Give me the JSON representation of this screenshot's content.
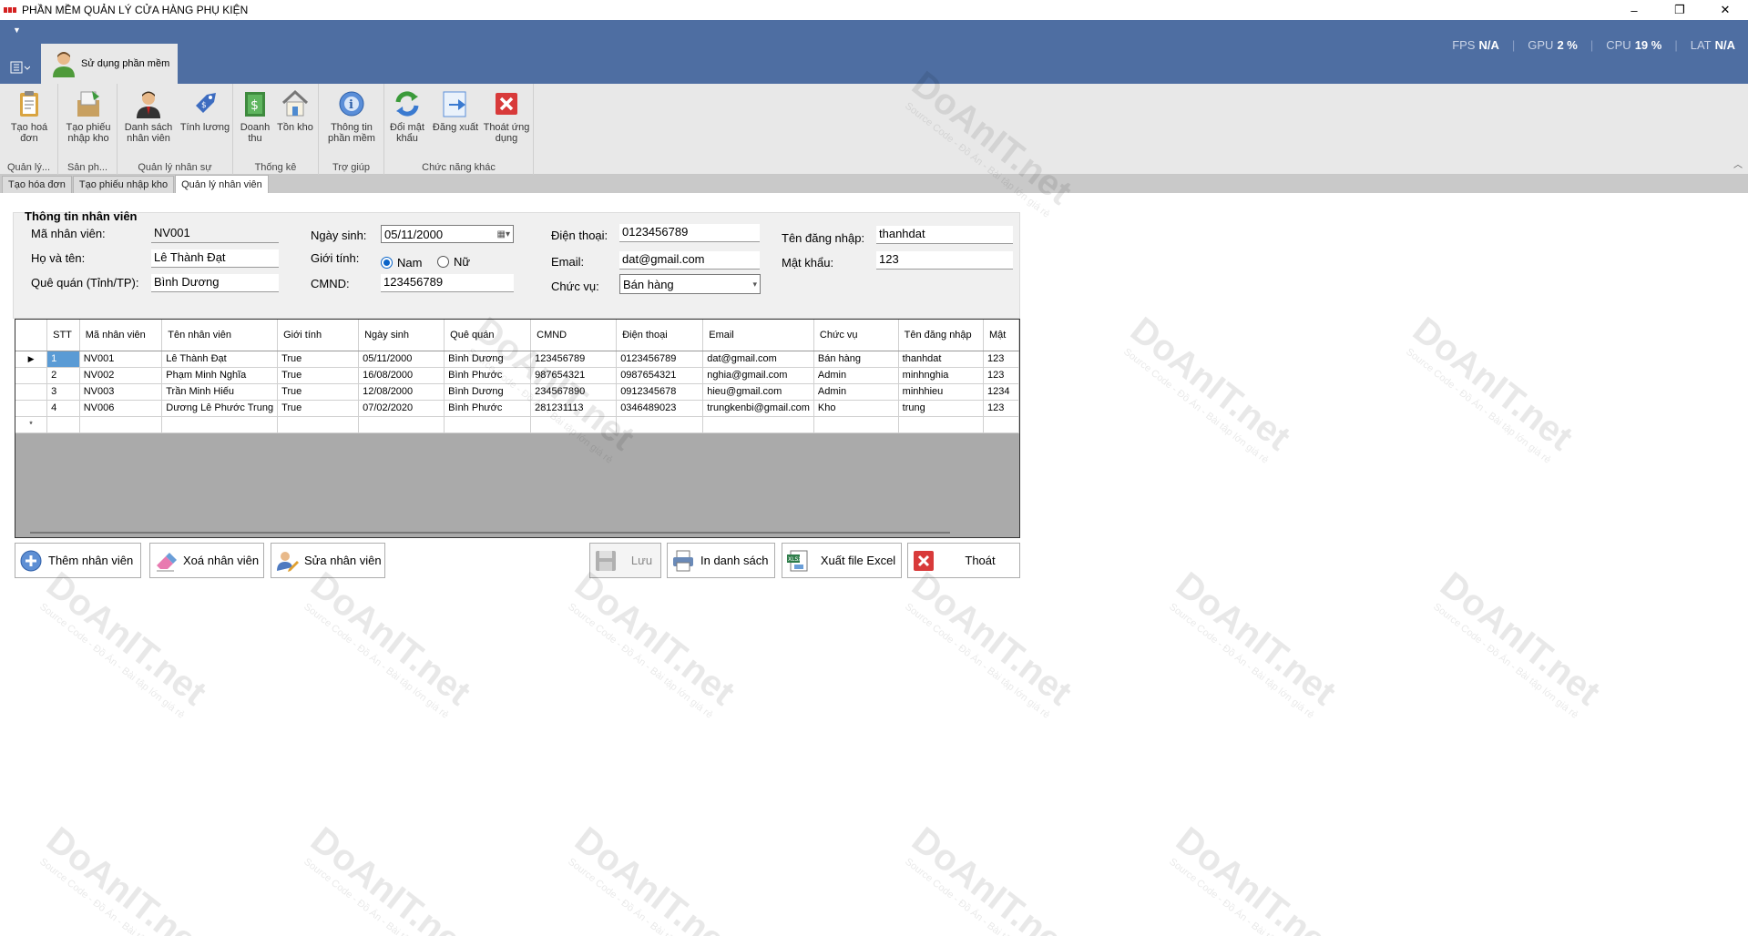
{
  "window": {
    "title": "PHẦN MỀM QUẢN LÝ CỬA HÀNG PHỤ KIỆN",
    "minimize": "–",
    "restore": "❐",
    "close": "✕"
  },
  "stats": [
    {
      "label": "FPS",
      "value": "N/A"
    },
    {
      "label": "GPU",
      "value": "2 %"
    },
    {
      "label": "CPU",
      "value": "19 %"
    },
    {
      "label": "LAT",
      "value": "N/A"
    }
  ],
  "ribbon": {
    "tab_label": "Sử dụng phần mềm",
    "groups": [
      {
        "label": "Quản lý..."
      },
      {
        "label": "Sản ph..."
      },
      {
        "label": "Quản lý nhân sự"
      },
      {
        "label": "Thống kê"
      },
      {
        "label": "Trợ giúp"
      },
      {
        "label": "Chức năng khác"
      }
    ],
    "buttons": {
      "create_invoice": "Tạo hoá đơn",
      "create_receipt": "Tạo phiếu nhập kho",
      "employee_list": "Danh sách nhân viên",
      "payroll": "Tính lương",
      "revenue": "Doanh thu",
      "stock": "Tồn kho",
      "info": "Thông tin phần mềm",
      "change_password": "Đổi mật khẩu",
      "logout": "Đăng xuất",
      "exit": "Thoát ứng dụng"
    }
  },
  "doc_tabs": [
    "Tạo hóa đơn",
    "Tạo phiếu nhập kho",
    "Quản lý nhân viên"
  ],
  "form": {
    "title": "Thông tin nhân viên",
    "labels": {
      "id": "Mã nhân viên:",
      "name": "Họ và tên:",
      "hometown": "Quê quán (Tỉnh/TP):",
      "dob": "Ngày sinh:",
      "gender": "Giới tính:",
      "cmnd": "CMND:",
      "phone": "Điện thoại:",
      "email": "Email:",
      "position": "Chức vụ:",
      "username": "Tên đăng nhập:",
      "password": "Mật khẩu:"
    },
    "values": {
      "id": "NV001",
      "name": "Lê Thành Đạt",
      "hometown": "Bình Dương",
      "dob": "05/11/2000",
      "gender_male": "Nam",
      "gender_female": "Nữ",
      "gender_selected": "Nam",
      "cmnd": "123456789",
      "phone": "0123456789",
      "email": "dat@gmail.com",
      "position": "Bán hàng",
      "username": "thanhdat",
      "password": "123"
    }
  },
  "grid": {
    "columns": [
      "STT",
      "Mã nhân viên",
      "Tên nhân viên",
      "Giới tính",
      "Ngày sinh",
      "Quê quán",
      "CMND",
      "Điện thoại",
      "Email",
      "Chức vụ",
      "Tên đăng nhập",
      "Mật"
    ],
    "rows": [
      [
        "1",
        "NV001",
        "Lê Thành Đạt",
        "True",
        "05/11/2000",
        "Bình Dương",
        "123456789",
        "0123456789",
        "dat@gmail.com",
        "Bán hàng",
        "thanhdat",
        "123"
      ],
      [
        "2",
        "NV002",
        "Phạm Minh Nghĩa",
        "True",
        "16/08/2000",
        "Bình Phước",
        "987654321",
        "0987654321",
        "nghia@gmail.com",
        "Admin",
        "minhnghia",
        "123"
      ],
      [
        "3",
        "NV003",
        "Trần Minh Hiếu",
        "True",
        "12/08/2000",
        "Bình Dương",
        "234567890",
        "0912345678",
        "hieu@gmail.com",
        "Admin",
        "minhhieu",
        "1234"
      ],
      [
        "4",
        "NV006",
        "Dương Lê Phước Trung",
        "True",
        "07/02/2020",
        "Bình Phước",
        "281231113",
        "0346489023",
        "trungkenbi@gmail.com",
        "Kho",
        "trung",
        "123"
      ]
    ],
    "selected_row": 0,
    "current_marker": "▶",
    "new_row_marker": "*"
  },
  "actions": {
    "add": "Thêm nhân viên",
    "delete": "Xoá nhân viên",
    "edit": "Sửa nhân viên",
    "save": "Lưu",
    "print": "In danh sách",
    "excel": "Xuất file Excel",
    "exit": "Thoát"
  },
  "watermark": {
    "brand": "DoAnIT.net",
    "tagline": "Source Code - Đồ Án - Bài tập lớn giá rẻ"
  },
  "colors": {
    "ribbon_header": "#4e6ea2",
    "selection": "#5a9bd5",
    "radio_accent": "#0a64c8"
  }
}
